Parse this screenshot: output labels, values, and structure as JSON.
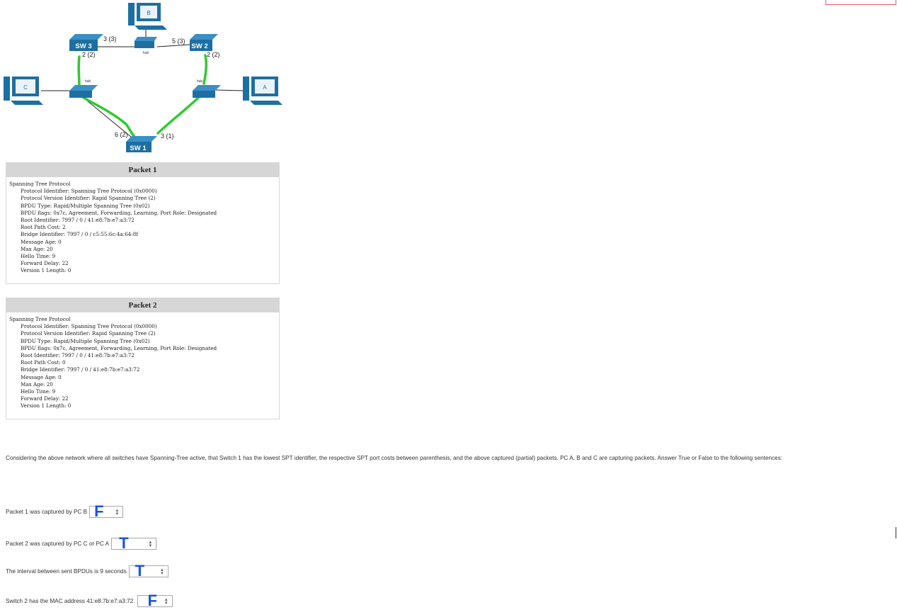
{
  "diagram": {
    "pcs": {
      "b": "B",
      "c": "C",
      "a": "A"
    },
    "switches": {
      "sw1": "SW 1",
      "sw2": "SW 2",
      "sw3": "SW 3"
    },
    "hub_label": "hub",
    "port_costs": {
      "sw3_right": "3 (3)",
      "sw3_down": "2 (2)",
      "sw2_left": "5 (3)",
      "sw2_down": "2 (2)",
      "sw1_left": "6 (2)",
      "sw1_right": "3 (1)"
    },
    "colors": {
      "device": "#1d6fa3",
      "active_link": "#2ecc2e",
      "link": "#222222"
    }
  },
  "packets": [
    {
      "title": "Packet 1",
      "header": "Spanning Tree Protocol",
      "fields": [
        "Protocol Identifier: Spanning Tree Protocol (0x0000)",
        "Protocol Version Identifier: Rapid Spanning Tree (2)",
        "BPDU Type: Rapid/Multiple Spanning Tree (0x02)",
        "BPDU flags: 0x7c, Agreement, Forwarding, Learning, Port Role: Designated",
        "Root Identifier: 7997 / 0 / 41:e8:7b:e7:a3:72",
        "Root Path Cost: 2",
        "Bridge Identifier: 7997 / 0 / c5:55:6c:4a:64:8f",
        "Message Age: 0",
        "Max Age: 20",
        "Hello Time: 9",
        "Forward Delay: 22",
        "Version 1 Length: 0"
      ]
    },
    {
      "title": "Packet 2",
      "header": "Spanning Tree Protocol",
      "fields": [
        "Protocol Identifier: Spanning Tree Protocol (0x0000)",
        "Protocol Version Identifier: Rapid Spanning Tree (2)",
        "BPDU Type: Rapid/Multiple Spanning Tree (0x02)",
        "BPDU flags: 0x7c, Agreement, Forwarding, Learning, Port Role: Designated",
        "Root Identifier: 7997 / 0 / 41:e8:7b:e7:a3:72",
        "Root Path Cost: 0",
        "Bridge Identifier: 7997 / 0 / 41:e8:7b:e7:a3:72",
        "Message Age: 0",
        "Max Age: 20",
        "Hello Time: 9",
        "Forward Delay: 22",
        "Version 1 Length: 0"
      ]
    }
  ],
  "question_text": "Considering the above network where all switches have Spanning-Tree active, that Switch 1 has the lowest SPT identifier, the respective SPT port costs between parenthesis, and the above captured (partial) packets. PC A, B and C are capturing packets. Answer True or False to the following sentences:",
  "answers": [
    {
      "sentence": "Packet 1 was captured by PC B",
      "mark": "F"
    },
    {
      "sentence": "Packet 2 was captured by PC C or PC A",
      "mark": "T"
    },
    {
      "sentence": "The interval between sent BPDUs is 9 seconds",
      "mark": "T"
    },
    {
      "sentence": "Switch 2 has the MAC address 41:e8:7b:e7:a3:72.",
      "mark": "F"
    }
  ],
  "select_arrow_icon": "up-down-arrows-icon",
  "mark_color": "#1b52e0"
}
